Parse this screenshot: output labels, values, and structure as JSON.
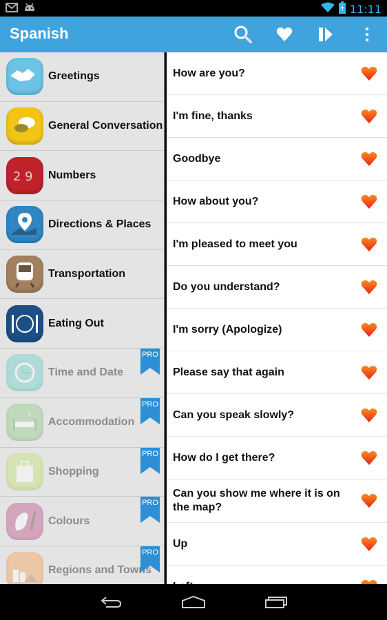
{
  "status_bar": {
    "notifications": [
      "gmail-icon",
      "android-icon"
    ],
    "wifi": "wifi-icon",
    "battery": "battery-charging-icon",
    "time": "11:11"
  },
  "action_bar": {
    "title": "Spanish",
    "actions": [
      "search-icon",
      "heart-icon",
      "play-icon",
      "overflow-menu-icon"
    ]
  },
  "categories": [
    {
      "label": "Greetings",
      "icon": "handshake-icon",
      "color": "#6cc3e6",
      "pro": false
    },
    {
      "label": "General Conversation",
      "icon": "speech-bubbles-icon",
      "color": "#f2c418",
      "pro": false
    },
    {
      "label": "Numbers",
      "icon": "numbers-icon",
      "color": "#c0222c",
      "pro": false
    },
    {
      "label": "Directions & Places",
      "icon": "map-pin-icon",
      "color": "#2f86c2",
      "pro": false
    },
    {
      "label": "Transportation",
      "icon": "train-icon",
      "color": "#a3805e",
      "pro": false
    },
    {
      "label": "Eating Out",
      "icon": "plate-cutlery-icon",
      "color": "#1d4f86",
      "pro": false
    },
    {
      "label": "Time and Date",
      "icon": "clock-icon",
      "color": "#6ed2c9",
      "pro": true
    },
    {
      "label": "Accommodation",
      "icon": "bed-icon",
      "color": "#93cd88",
      "pro": true
    },
    {
      "label": "Shopping",
      "icon": "shopping-bag-icon",
      "color": "#c6e279",
      "pro": true
    },
    {
      "label": "Colours",
      "icon": "palette-icon",
      "color": "#c45a8e",
      "pro": true
    },
    {
      "label": "Regions and Towns",
      "icon": "city-icon",
      "color": "#f5a25f",
      "pro": true
    }
  ],
  "pro_badge_label": "PRO",
  "phrases": [
    {
      "text": "How are you?",
      "favorite": true
    },
    {
      "text": "I'm fine, thanks",
      "favorite": true
    },
    {
      "text": "Goodbye",
      "favorite": true
    },
    {
      "text": "How about you?",
      "favorite": true
    },
    {
      "text": "I'm pleased to meet you",
      "favorite": true
    },
    {
      "text": "Do you understand?",
      "favorite": true
    },
    {
      "text": "I'm sorry (Apologize)",
      "favorite": true
    },
    {
      "text": "Please say that again",
      "favorite": true
    },
    {
      "text": "Can you speak slowly?",
      "favorite": true
    },
    {
      "text": "How do I get there?",
      "favorite": true
    },
    {
      "text": "Can you show me where it is on the map?",
      "favorite": true
    },
    {
      "text": "Up",
      "favorite": true
    },
    {
      "text": "Left",
      "favorite": true
    }
  ],
  "colors": {
    "action_bar": "#3fa3de",
    "heart": "#f2571b",
    "pro_badge": "#2d8fd5",
    "clock": "#33b5e5"
  },
  "nav_bar": [
    "back-icon",
    "home-icon",
    "recent-apps-icon"
  ]
}
